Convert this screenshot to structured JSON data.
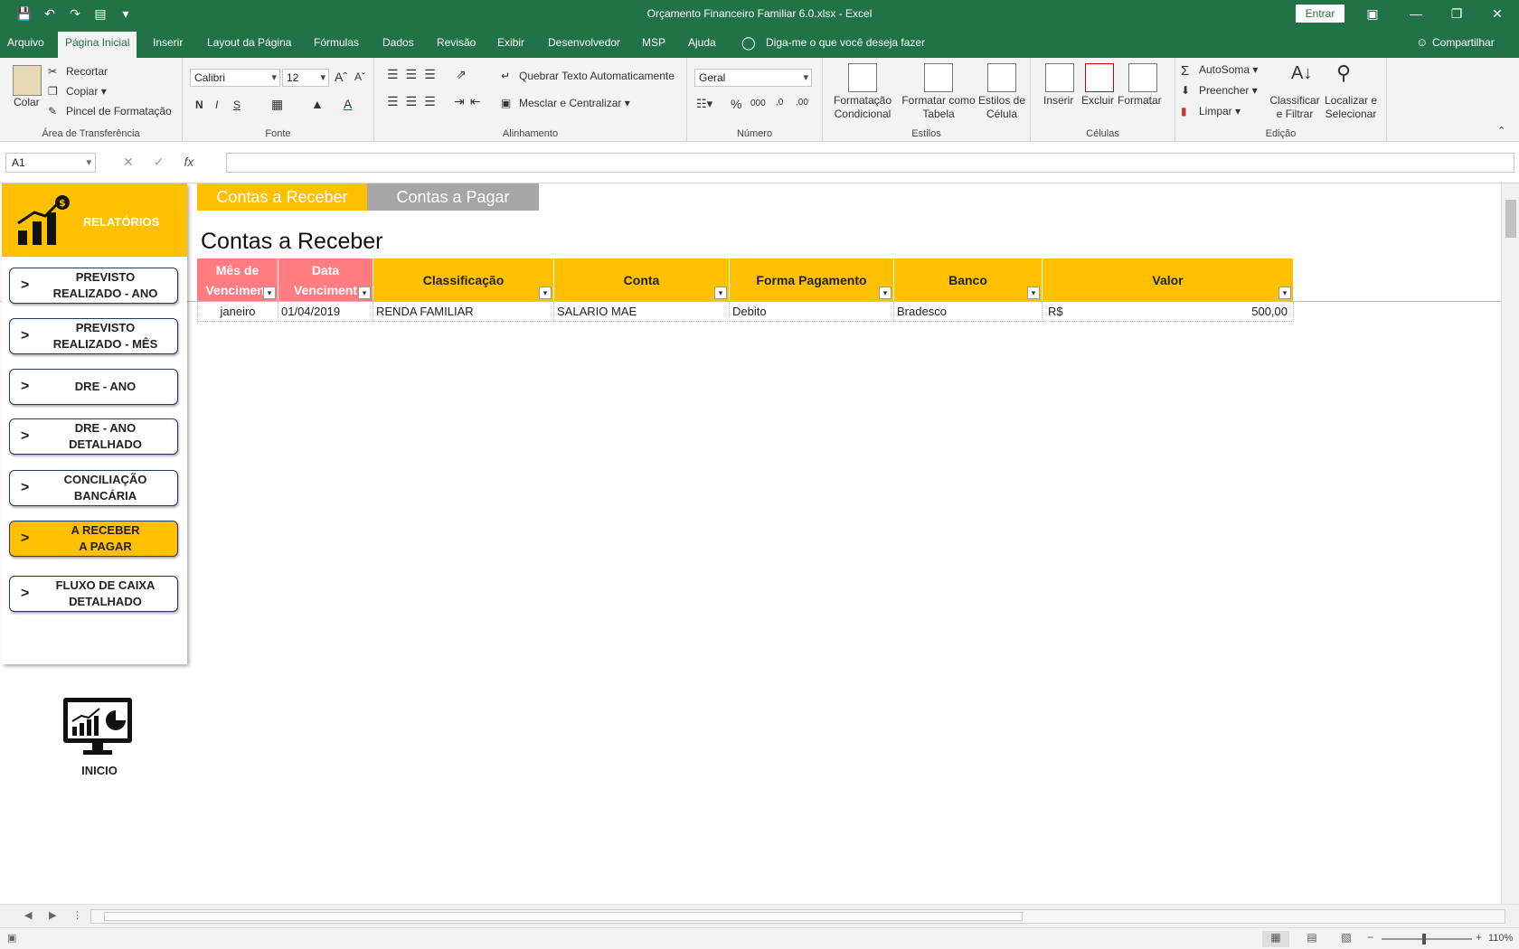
{
  "window": {
    "title": "Orçamento Financeiro Familiar 6.0.xlsx  -  Excel",
    "signin": "Entrar"
  },
  "menu": {
    "tabs": [
      "Arquivo",
      "Página Inicial",
      "Inserir",
      "Layout da Página",
      "Fórmulas",
      "Dados",
      "Revisão",
      "Exibir",
      "Desenvolvedor",
      "MSP",
      "Ajuda"
    ],
    "tell_me": "Diga-me o que você deseja fazer",
    "share": "Compartilhar"
  },
  "ribbon": {
    "clipboard": {
      "label": "Área de Transferência",
      "paste": "Colar",
      "cut": "Recortar",
      "copy": "Copiar",
      "format_painter": "Pincel de Formatação"
    },
    "font": {
      "label": "Fonte",
      "family": "Calibri",
      "size": "12",
      "bold": "N",
      "italic": "I",
      "underline": "S"
    },
    "alignment": {
      "label": "Alinhamento",
      "wrap": "Quebrar Texto Automaticamente",
      "merge": "Mesclar e Centralizar"
    },
    "number": {
      "label": "Número",
      "format": "Geral"
    },
    "styles": {
      "label": "Estilos",
      "conditional": "Formatação\nCondicional",
      "as_table": "Formatar como\nTabela",
      "cell_styles": "Estilos de\nCélula"
    },
    "cells": {
      "label": "Células",
      "insert": "Inserir",
      "delete": "Excluir",
      "format": "Formatar"
    },
    "editing": {
      "label": "Edição",
      "autosum": "AutoSoma",
      "fill": "Preencher",
      "clear": "Limpar",
      "sort": "Classificar\ne Filtrar",
      "find": "Localizar e\nSelecionar"
    }
  },
  "formula_bar": {
    "name_box": "A1",
    "fx": "fx"
  },
  "sidebar": {
    "header": "RELATÓRIOS",
    "items": [
      {
        "label": "PREVISTO\nREALIZADO - ANO"
      },
      {
        "label": "PREVISTO\nREALIZADO - MÊS"
      },
      {
        "label": "DRE - ANO"
      },
      {
        "label": "DRE - ANO\nDETALHADO"
      },
      {
        "label": "CONCILIAÇÃO\nBANCÁRIA"
      },
      {
        "label": "A RECEBER\nA PAGAR"
      },
      {
        "label": "FLUXO DE CAIXA\nDETALHADO"
      }
    ],
    "arrow": ">",
    "home": "INICIO"
  },
  "sheet_tabs": {
    "receive": "Contas a Receber",
    "pay": "Contas a Pagar"
  },
  "section_title": "Contas a Receber",
  "table": {
    "headers": [
      "Mês de Venciment",
      "Data Venciment",
      "Classificação",
      "Conta",
      "Forma Pagamento",
      "Banco",
      "Valor"
    ],
    "rows": [
      {
        "mes": "janeiro",
        "data": "01/04/2019",
        "classificacao": "RENDA FAMILIAR",
        "conta": "SALARIO MAE",
        "forma": "Debito",
        "banco": "Bradesco",
        "moeda": "R$",
        "valor": "500,00"
      }
    ]
  },
  "status": {
    "zoom": "110%"
  },
  "colors": {
    "excel_green": "#217346",
    "gold": "#ffc000",
    "pink": "#ff7c80",
    "gray_tab": "#a6a6a6"
  }
}
